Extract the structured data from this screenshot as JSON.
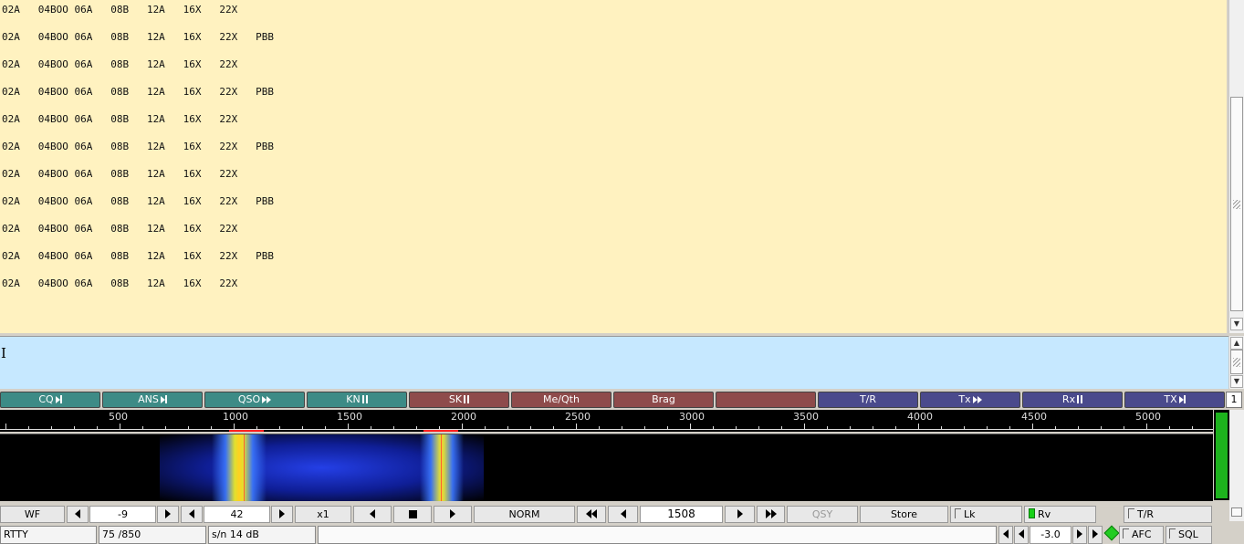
{
  "rx_text": {
    "lines": [
      "02A   04BOO 06A   08B   12A   16X   22X",
      "02A   04BOO 06A   08B   12A   16X   22X   PBB",
      "02A   04BOO 06A   08B   12A   16X   22X",
      "02A   04BOO 06A   08B   12A   16X   22X   PBB",
      "02A   04BOO 06A   08B   12A   16X   22X",
      "02A   04BOO 06A   08B   12A   16X   22X   PBB",
      "02A   04BOO 06A   08B   12A   16X   22X",
      "02A   04BOO 06A   08B   12A   16X   22X   PBB",
      "02A   04BOO 06A   08B   12A   16X   22X",
      "02A   04BOO 06A   08B   12A   16X   22X   PBB",
      "02A   04BOO 06A   08B   12A   16X   22X"
    ]
  },
  "tx_text": {
    "value": ""
  },
  "macros": [
    {
      "label": "CQ",
      "icon": "play-bar-icon"
    },
    {
      "label": "ANS",
      "icon": "play-bar-icon"
    },
    {
      "label": "QSO",
      "icon": "fast-forward-icon"
    },
    {
      "label": "KN",
      "icon": "pause-icon"
    },
    {
      "label": "SK",
      "icon": "pause-icon"
    },
    {
      "label": "Me/Qth",
      "icon": ""
    },
    {
      "label": "Brag",
      "icon": ""
    },
    {
      "label": "",
      "icon": ""
    },
    {
      "label": "T/R",
      "icon": ""
    },
    {
      "label": "Tx",
      "icon": "fast-forward-icon"
    },
    {
      "label": "Rx",
      "icon": "pause-icon"
    },
    {
      "label": "TX",
      "icon": "play-bar-icon"
    }
  ],
  "macro_set_number": "1",
  "scale_labels": [
    "500",
    "1000",
    "1500",
    "2000",
    "2500",
    "3000",
    "3500",
    "4000",
    "4500",
    "5000"
  ],
  "controls": {
    "wf_button": "WF",
    "ref_level": "-9",
    "amp_level": "42",
    "zoom": "x1",
    "speed": "NORM",
    "frequency": "1508",
    "qsy": "QSY",
    "store": "Store",
    "lock": "Lk",
    "reverse": "Rv",
    "tr": "T/R"
  },
  "status": {
    "mode": "RTTY",
    "baud_shift": "75 /850",
    "snr": "s/n 14  dB",
    "message": "",
    "squelch_value": "-3.0",
    "afc": "AFC",
    "sql": "SQL"
  },
  "colors": {
    "rx_background": "#fff2c0",
    "tx_background": "#c6e8ff",
    "macro_teal": "#3d8b86",
    "macro_red": "#8e4b4b",
    "macro_blue": "#4a4a8c",
    "marker": "#ff2020"
  }
}
